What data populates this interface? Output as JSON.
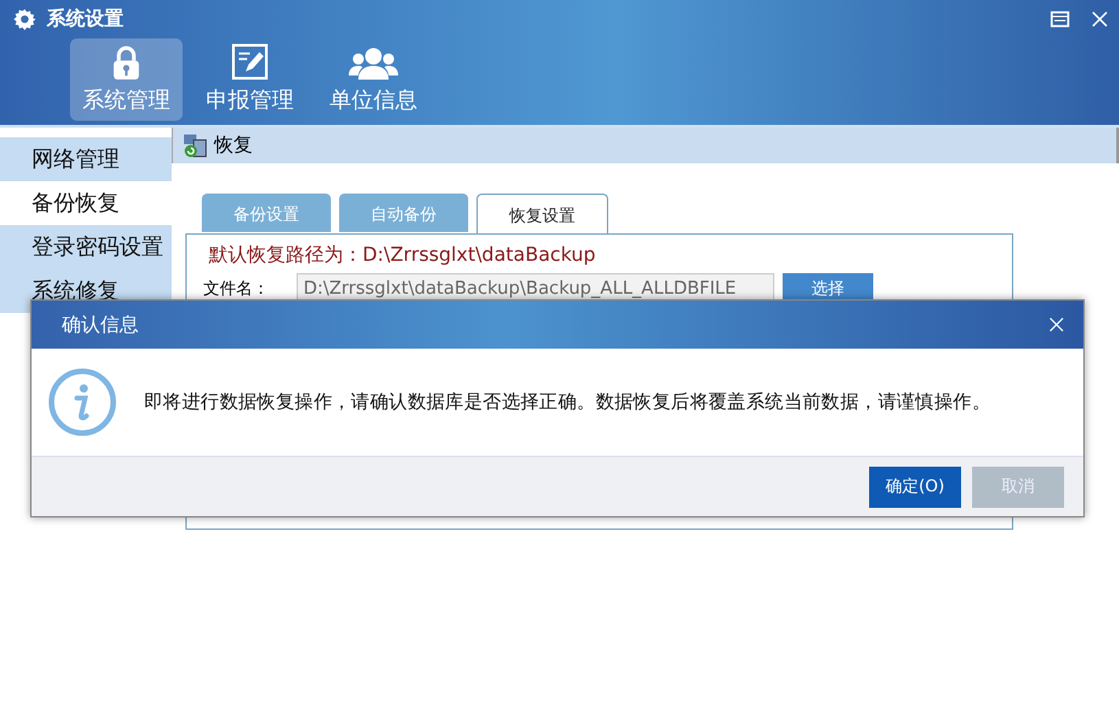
{
  "window": {
    "title": "系统设置"
  },
  "nav": [
    {
      "label": "系统管理",
      "selected": true
    },
    {
      "label": "申报管理",
      "selected": false
    },
    {
      "label": "单位信息",
      "selected": false
    }
  ],
  "sidebar": {
    "items": [
      {
        "label": "网络管理",
        "selected": false
      },
      {
        "label": "备份恢复",
        "selected": true
      },
      {
        "label": "登录密码设置",
        "selected": false
      },
      {
        "label": "系统修复",
        "selected": false
      }
    ]
  },
  "section": {
    "title": "恢复"
  },
  "tabs": [
    {
      "label": "备份设置",
      "selected": false
    },
    {
      "label": "自动备份",
      "selected": false
    },
    {
      "label": "恢复设置",
      "selected": true
    }
  ],
  "restore": {
    "default_path": "默认恢复路径为：D:\\Zrrssglxt\\dataBackup",
    "file_label": "文件名：",
    "file_value": "D:\\Zrrssglxt\\dataBackup\\Backup_ALL_ALLDBFILE",
    "choose_button": "选择"
  },
  "dialog": {
    "title": "确认信息",
    "message": "即将进行数据恢复操作，请确认数据库是否选择正确。数据恢复后将覆盖系统当前数据，请谨慎操作。",
    "buttons": [
      {
        "label": "确定(O)",
        "disabled": false
      },
      {
        "label": "取消",
        "disabled": true
      }
    ]
  }
}
